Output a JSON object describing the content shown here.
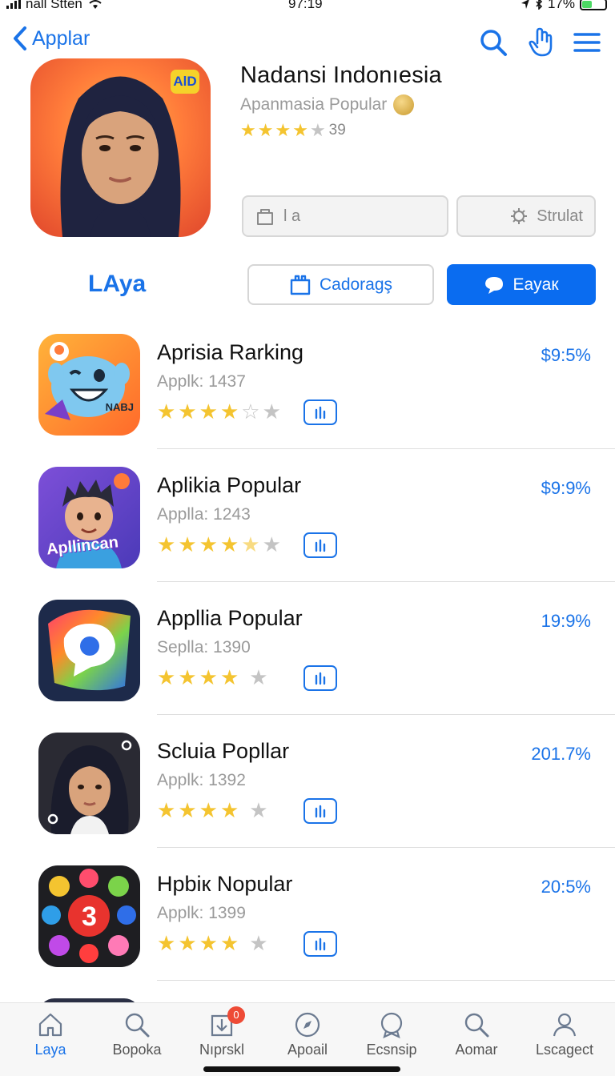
{
  "status_bar": {
    "carrier": "nall Stten",
    "time": "97:19",
    "battery": "17%"
  },
  "nav": {
    "back_label": "Applar"
  },
  "hero": {
    "badge": "AlD",
    "title": "Nadansi Indonıesia",
    "subtitle": "Apanmasia Popular",
    "rating_count": "39",
    "stars": 4,
    "buttons": [
      {
        "label": "l a",
        "icon": "bag-icon"
      },
      {
        "label": "Strulat",
        "icon": "gear-icon"
      }
    ]
  },
  "section": {
    "title": "LAya",
    "outline_button": "Cadoragş",
    "primary_button": "Eayaк"
  },
  "list": {
    "items": [
      {
        "title": "Aprisia Rarking",
        "subtitle": "Applk: 1437",
        "value": "$9:5%",
        "stars": 4,
        "half": true
      },
      {
        "title": "Aplikia Popular",
        "subtitle": "Applla: 1243",
        "value": "$9:9%",
        "stars": 4,
        "half": true
      },
      {
        "title": "Appllia Popular",
        "subtitle": "Seplla: 1390",
        "value": "19:9%",
        "stars": 4,
        "half": false
      },
      {
        "title": "Scluia Popllar",
        "subtitle": "Applk: 1392",
        "value": "201.7%",
        "stars": 4,
        "half": false
      },
      {
        "title": "Hpbiк Nopular",
        "subtitle": "Applk: 1399",
        "value": "20:5%",
        "stars": 4,
        "half": false
      }
    ],
    "icon_texts": {
      "item0": "NABJ",
      "item1": "Apllincan",
      "item4": "3"
    }
  },
  "tabbar": {
    "tabs": [
      {
        "label": "Laya",
        "icon": "home-icon"
      },
      {
        "label": "Bopoka",
        "icon": "search-icon"
      },
      {
        "label": "Nıprskl",
        "icon": "download-icon",
        "badge": "0"
      },
      {
        "label": "Apoail",
        "icon": "compass-icon"
      },
      {
        "label": "Ecsnsip",
        "icon": "badge-icon"
      },
      {
        "label": "Aomar",
        "icon": "search-icon"
      },
      {
        "label": "Lscagect",
        "icon": "person-icon"
      }
    ]
  },
  "colors": {
    "accent": "#1a73e8",
    "primary_button": "#0a6cf0",
    "star": "#f4c430",
    "badge": "#ee4b36"
  }
}
